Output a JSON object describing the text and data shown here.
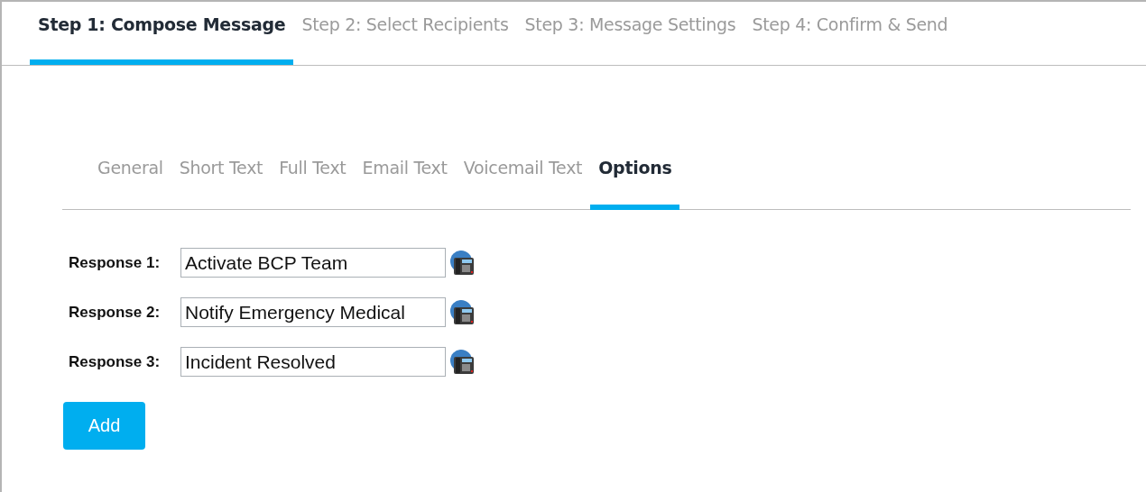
{
  "steps": [
    {
      "label": "Step 1: Compose Message",
      "selected": true
    },
    {
      "label": "Step 2: Select Recipients",
      "selected": false
    },
    {
      "label": "Step 3: Message Settings",
      "selected": false
    },
    {
      "label": "Step 4: Confirm & Send",
      "selected": false
    }
  ],
  "tabs": [
    {
      "label": "General",
      "selected": false
    },
    {
      "label": "Short Text",
      "selected": false
    },
    {
      "label": "Full Text",
      "selected": false
    },
    {
      "label": "Email Text",
      "selected": false
    },
    {
      "label": "Voicemail Text",
      "selected": false
    },
    {
      "label": "Options",
      "selected": true
    }
  ],
  "responses": [
    {
      "label": "Response 1:",
      "value": "Activate BCP Team"
    },
    {
      "label": "Response 2:",
      "value": "Notify Emergency Medical"
    },
    {
      "label": "Response 3:",
      "value": "Incident Resolved"
    }
  ],
  "add_button": "Add"
}
